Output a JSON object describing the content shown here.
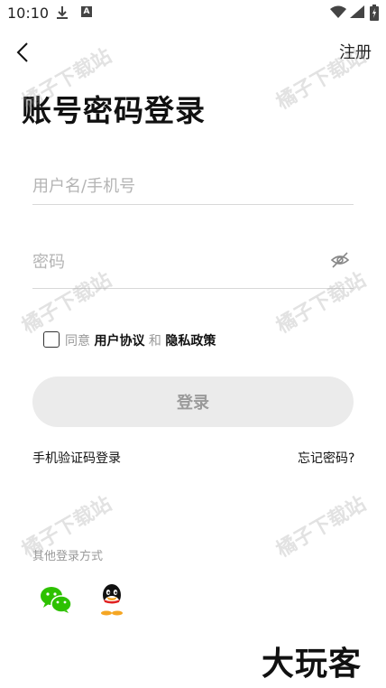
{
  "status_bar": {
    "time": "10:10"
  },
  "header": {
    "register_label": "注册",
    "title": "账号密码登录"
  },
  "form": {
    "username_placeholder": "用户名/手机号",
    "password_placeholder": "密码",
    "agreement": {
      "prefix": "同意",
      "user_agreement": "用户协议",
      "and": "和",
      "privacy_policy": "隐私政策"
    },
    "login_label": "登录"
  },
  "links": {
    "sms_login": "手机验证码登录",
    "forgot_password": "忘记密码?"
  },
  "other_login": {
    "label": "其他登录方式",
    "wechat_color": "#2dc100",
    "qq_color": "#111111"
  },
  "watermark": {
    "text": "橘子下载站"
  },
  "brand": {
    "text": "大玩客"
  }
}
